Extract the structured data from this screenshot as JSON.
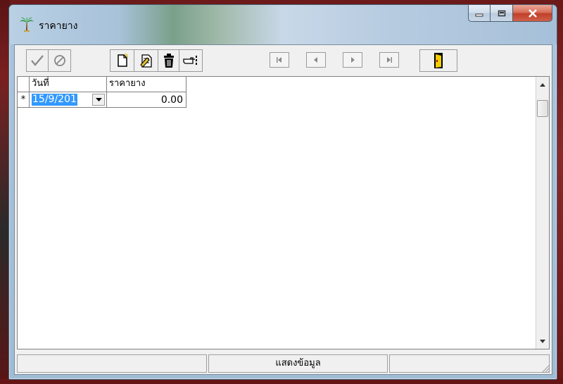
{
  "window": {
    "title": "ราคายาง",
    "buttons": {
      "minimize": "minimize",
      "maximize": "maximize",
      "close": "close"
    }
  },
  "toolbar": {
    "groups": [
      [
        "check-icon",
        "cancel-icon"
      ],
      [
        "new-record-icon",
        "edit-record-icon",
        "delete-trash-icon",
        "pointing-hand-icon"
      ],
      [
        "first-record-icon",
        "previous-record-icon",
        "next-record-icon",
        "last-record-icon"
      ],
      [
        "exit-door-icon"
      ]
    ]
  },
  "grid": {
    "columns": [
      "วันที่",
      "ราคายาง"
    ],
    "rows": [
      {
        "indicator": "*",
        "date": "15/9/201",
        "price": "0.00"
      }
    ]
  },
  "statusbar": {
    "panels": [
      "",
      "แสดงข้อมูล",
      ""
    ]
  }
}
